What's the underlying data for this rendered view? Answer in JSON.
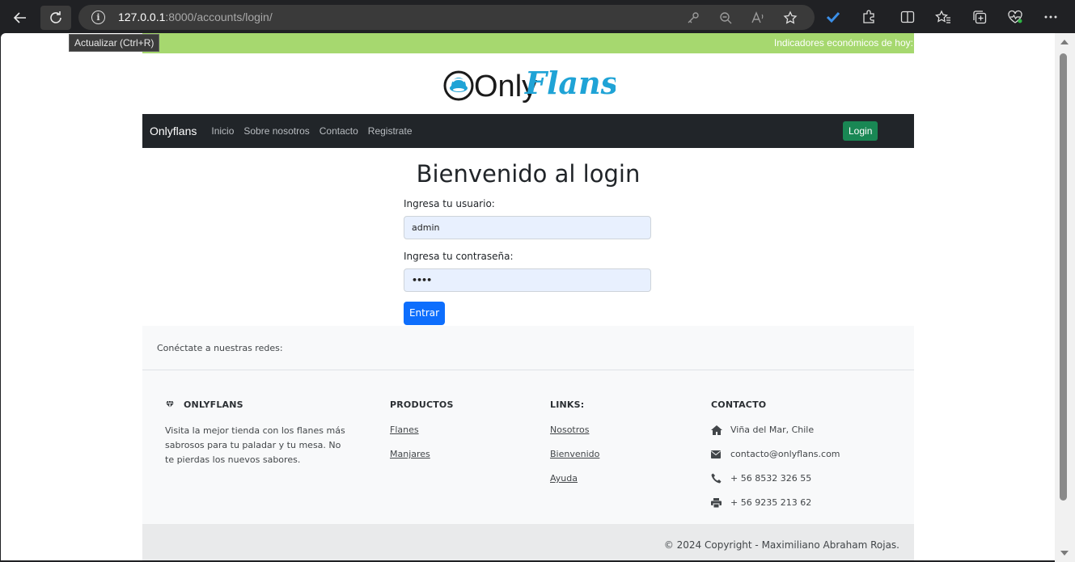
{
  "browser": {
    "url_host": "127.0.0.1",
    "url_path": ":8000/accounts/login/",
    "tooltip": "Actualizar (Ctrl+R)"
  },
  "topbar": {
    "indicators_text": "Indicadores económicos de hoy:"
  },
  "logo": {
    "part1": "Only",
    "part2": "Flans"
  },
  "nav": {
    "brand": "Onlyflans",
    "links": [
      "Inicio",
      "Sobre nosotros",
      "Contacto",
      "Registrate"
    ],
    "login_label": "Login"
  },
  "login": {
    "title": "Bienvenido al login",
    "username_label": "Ingresa tu usuario:",
    "username_value": "admin",
    "password_label": "Ingresa tu contraseña:",
    "password_value": "••••",
    "submit_label": "Entrar"
  },
  "footer": {
    "social_text": "Conéctate a nuestras redes:",
    "brand_heading": "ONLYFLANS",
    "brand_text": "Visita la mejor tienda con los flanes más sabrosos para tu paladar y tu mesa. No te pierdas los nuevos sabores.",
    "products_heading": "PRODUCTOS",
    "products": [
      "Flanes",
      "Manjares"
    ],
    "links_heading": "LINKS:",
    "links": [
      "Nosotros",
      "Bienvenido",
      "Ayuda"
    ],
    "contact_heading": "CONTACTO",
    "contact": [
      {
        "icon": "home-icon",
        "text": "Viña del Mar, Chile"
      },
      {
        "icon": "envelope-icon",
        "text": "contacto@onlyflans.com"
      },
      {
        "icon": "phone-icon",
        "text": "+ 56 8532 326 55"
      },
      {
        "icon": "print-icon",
        "text": "+ 56 9235 213 62"
      }
    ],
    "copyright": "© 2024 Copyright - Maximiliano Abraham Rojas."
  },
  "colors": {
    "topbar": "#a6d86f",
    "navbar": "#212529",
    "login_button": "#198754",
    "submit_button": "#0d6efd",
    "logo_blue": "#1fa3d6"
  }
}
